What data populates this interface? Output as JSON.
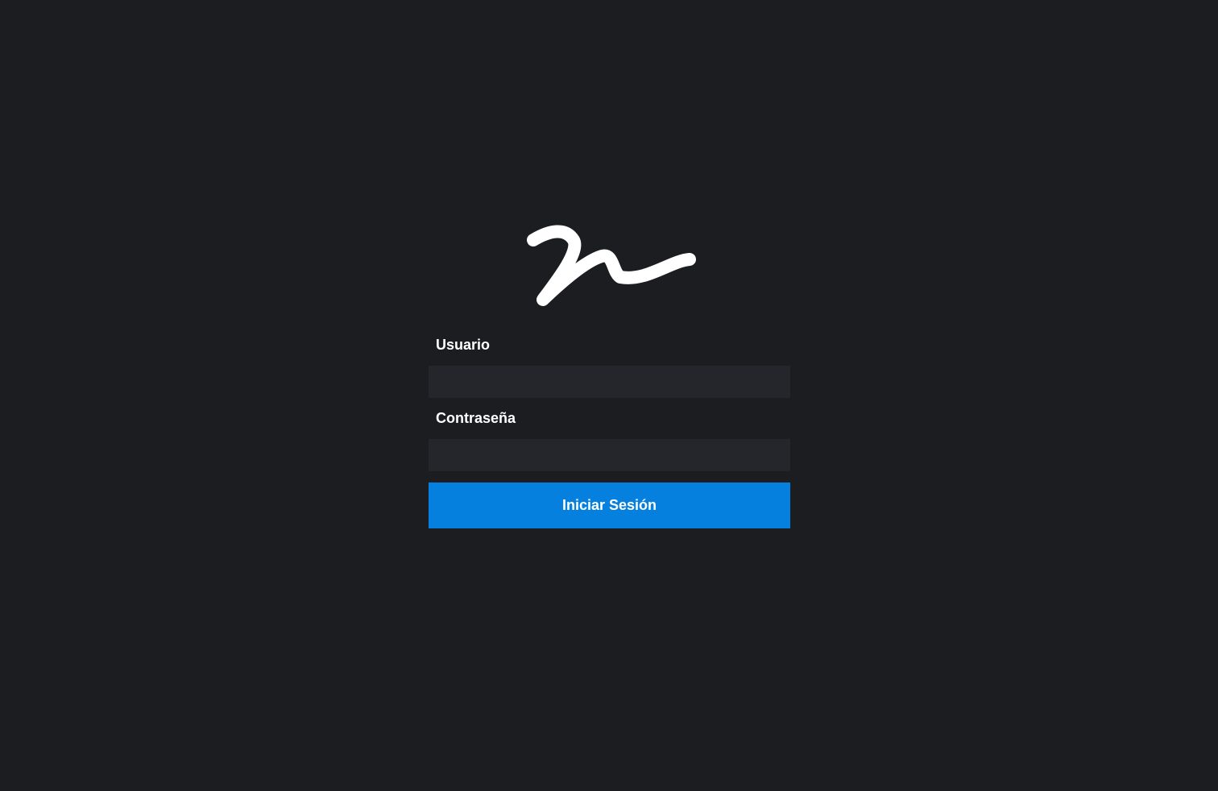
{
  "logo": {
    "icon": "brand-signature-logo",
    "color": "#ffffff"
  },
  "form": {
    "username_label": "Usuario",
    "username_value": "",
    "password_label": "Contraseña",
    "password_value": "",
    "submit_label": "Iniciar Sesión"
  },
  "colors": {
    "background": "#1c1d21",
    "input_background": "#25262c",
    "accent": "#0680df",
    "text": "#ffffff"
  }
}
